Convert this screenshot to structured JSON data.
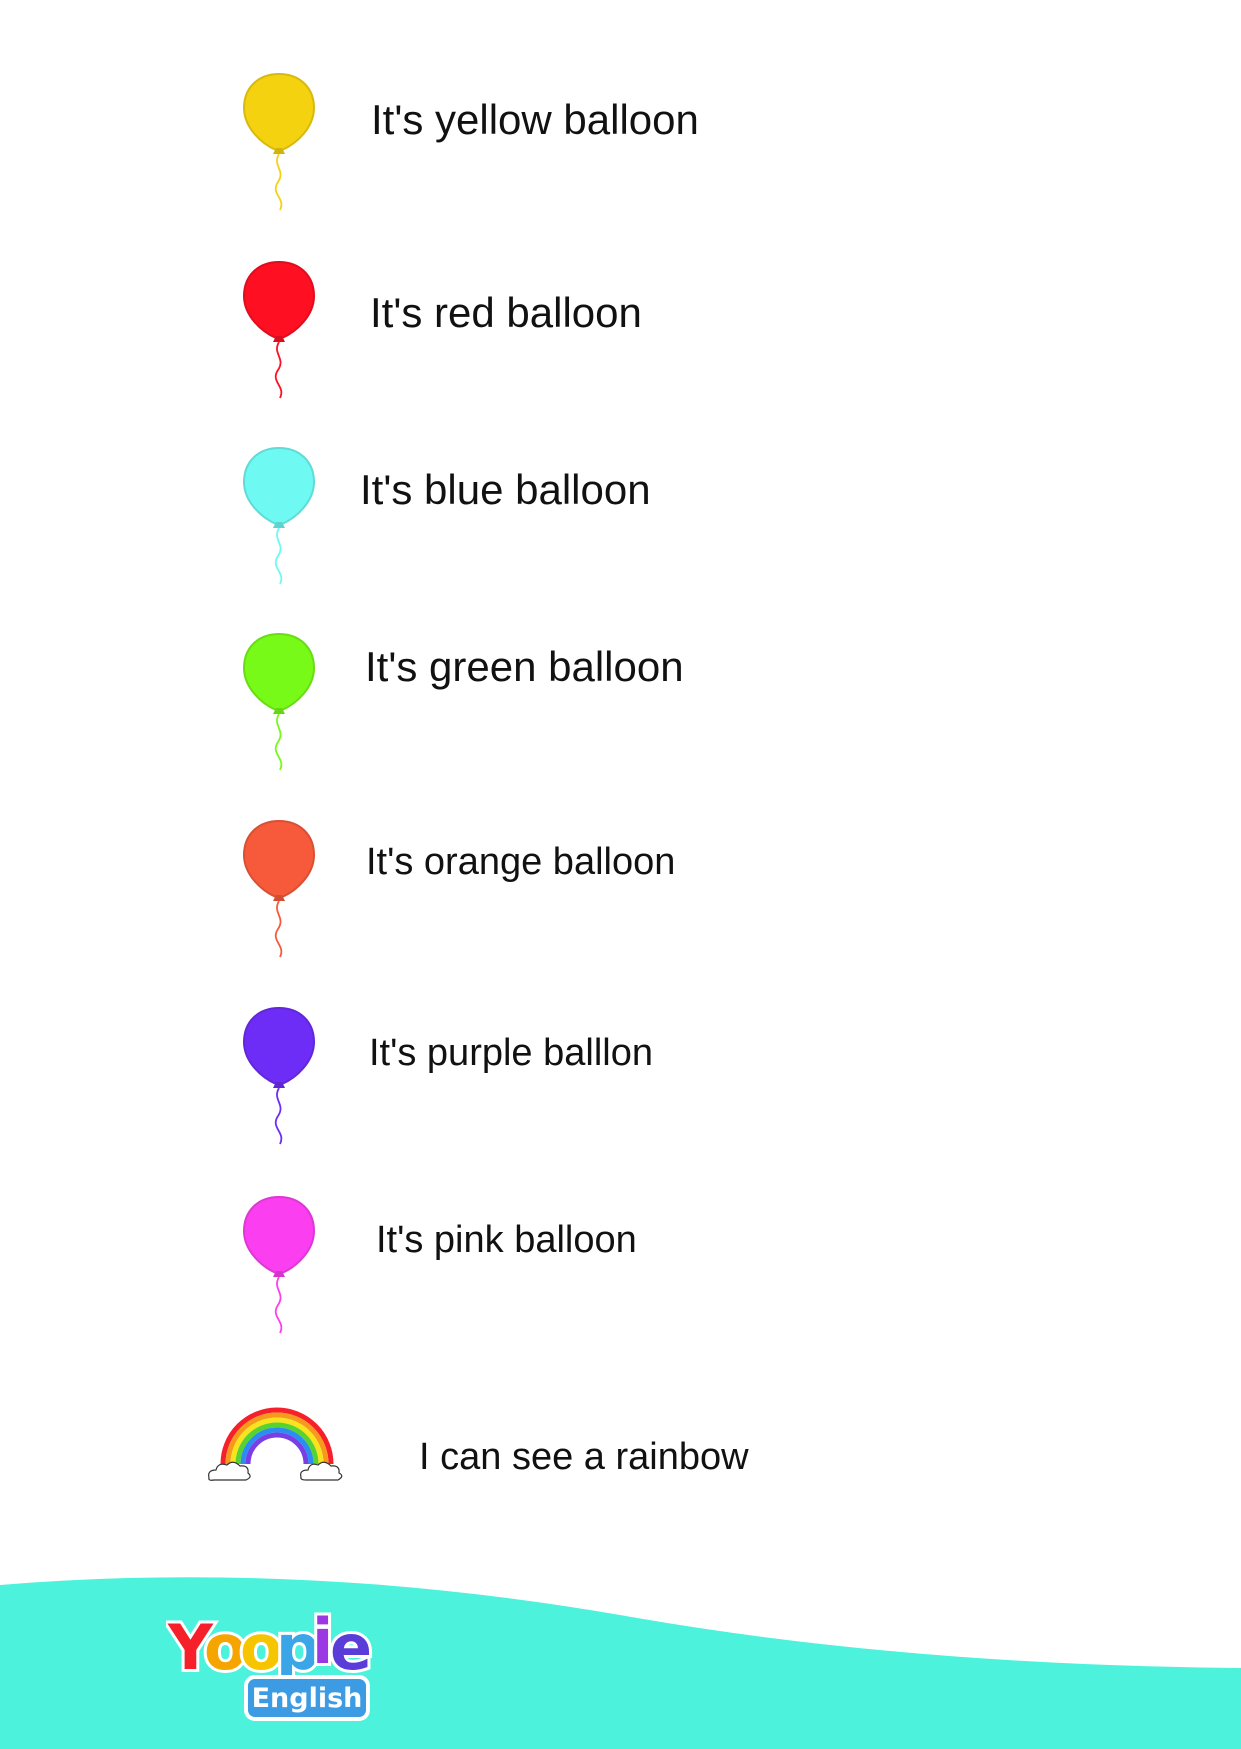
{
  "balloons": [
    {
      "label": "It's yellow balloon",
      "color": "#f5d20f",
      "icon": "yellow-balloon-icon"
    },
    {
      "label": "It's red balloon",
      "color": "#fe0f22",
      "icon": "red-balloon-icon"
    },
    {
      "label": "It's blue balloon",
      "color": "#6ef9f2",
      "icon": "blue-balloon-icon"
    },
    {
      "label": "It's green balloon",
      "color": "#77fa17",
      "icon": "green-balloon-icon"
    },
    {
      "label": "It's orange balloon",
      "color": "#f75a3b",
      "icon": "orange-balloon-icon"
    },
    {
      "label": "It's purple balllon",
      "color": "#6e2cf7",
      "icon": "purple-balloon-icon"
    },
    {
      "label": "It's pink balloon",
      "color": "#fc3ef1",
      "icon": "pink-balloon-icon"
    }
  ],
  "rainbow": {
    "label": "I can see a rainbow",
    "icon": "rainbow-icon"
  },
  "logo": {
    "letters": [
      "Y",
      "o",
      "o",
      "p",
      "i",
      "e"
    ],
    "letter_colors": [
      "#f5202a",
      "#f6a400",
      "#f6c500",
      "#3aa6e8",
      "#9b38e4",
      "#5a3cd9"
    ],
    "subtitle": "English",
    "subtitle_color": "#3d9be3"
  },
  "footer_color": "#4cf2dc"
}
